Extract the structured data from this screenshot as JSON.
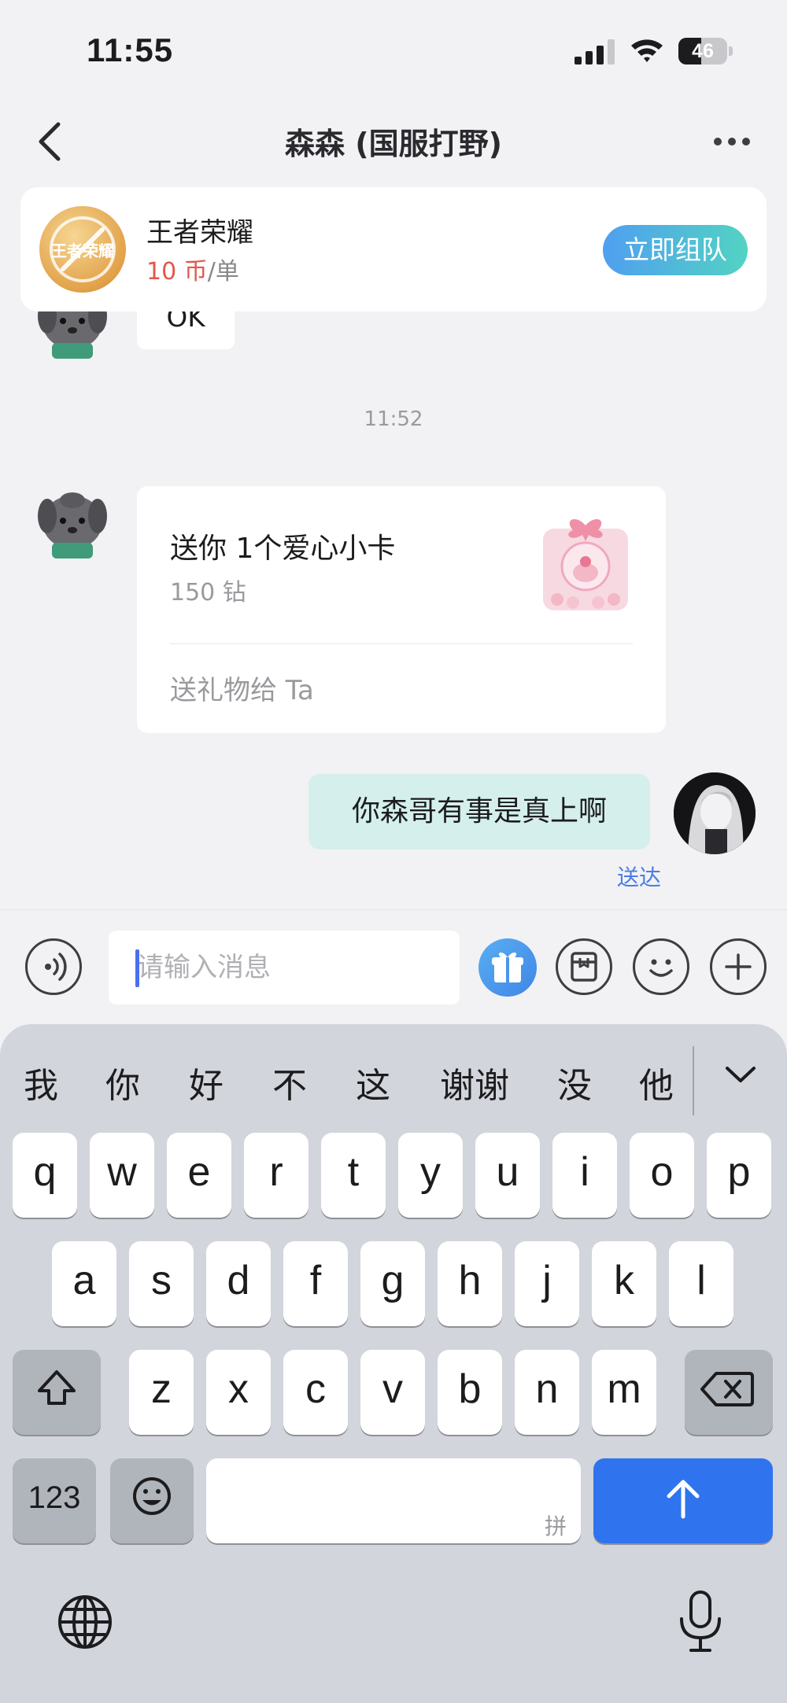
{
  "status_bar": {
    "time": "11:55",
    "battery": "46",
    "battery_level": 0.46
  },
  "nav": {
    "title": "森森 (国服打野)"
  },
  "game_card": {
    "logo_text": "王者荣耀",
    "name": "王者荣耀",
    "price_amount": "10 币",
    "price_unit": "/单",
    "team_button": "立即组队"
  },
  "messages": {
    "partial_bubble": "OK",
    "timestamp": "11:52",
    "gift": {
      "title": "送你 1个爱心小卡",
      "price": "150 钻",
      "action": "送礼物给 Ta"
    },
    "my_text": "你森哥有事是真上啊",
    "status": "送达"
  },
  "input": {
    "placeholder": "请输入消息"
  },
  "keyboard": {
    "suggestions": [
      "我",
      "你",
      "好",
      "不",
      "这",
      "谢谢",
      "没",
      "他"
    ],
    "row1": [
      "q",
      "w",
      "e",
      "r",
      "t",
      "y",
      "u",
      "i",
      "o",
      "p"
    ],
    "row2": [
      "a",
      "s",
      "d",
      "f",
      "g",
      "h",
      "j",
      "k",
      "l"
    ],
    "row3": [
      "z",
      "x",
      "c",
      "v",
      "b",
      "n",
      "m"
    ],
    "numbers_key": "123",
    "space_hint": "拼"
  },
  "colors": {
    "accent_blue": "#2f74ee",
    "price_red": "#e0584e",
    "my_bubble": "#d5f0ec"
  }
}
